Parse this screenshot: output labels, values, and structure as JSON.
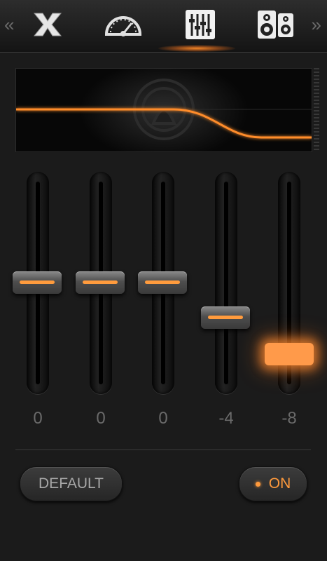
{
  "nav": {
    "prev": "«",
    "next": "»",
    "tabs": [
      {
        "icon": "x-logo-icon"
      },
      {
        "icon": "speedometer-icon"
      },
      {
        "icon": "equalizer-icon",
        "active": true
      },
      {
        "icon": "speakers-icon"
      }
    ]
  },
  "equalizer": {
    "bands": [
      {
        "value_label": "0",
        "level": 0,
        "active": false
      },
      {
        "value_label": "0",
        "level": 0,
        "active": false
      },
      {
        "value_label": "0",
        "level": 0,
        "active": false
      },
      {
        "value_label": "-4",
        "level": -4,
        "active": false
      },
      {
        "value_label": "-8",
        "level": -8,
        "active": true
      }
    ]
  },
  "buttons": {
    "default_label": "DEFAULT",
    "on_label": "ON"
  },
  "colors": {
    "accent": "#ff9a3c",
    "background": "#1b1b1b"
  }
}
